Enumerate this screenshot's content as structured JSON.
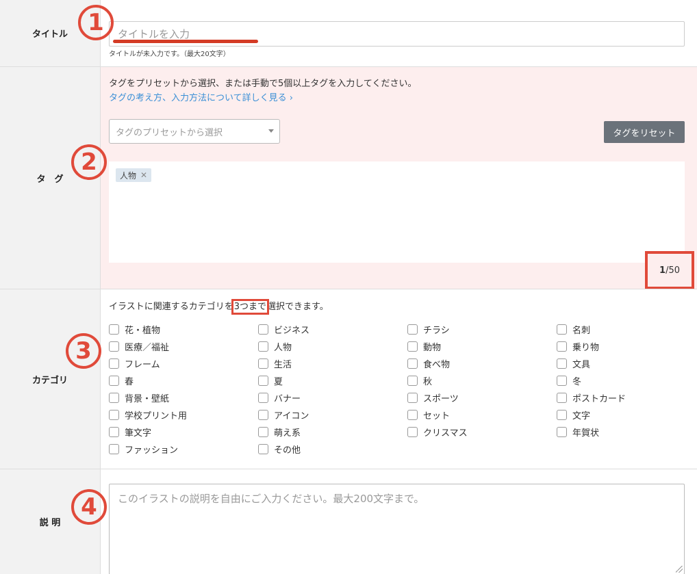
{
  "title_row": {
    "label": "タイトル",
    "placeholder": "タイトルを入力",
    "help": "タイトルが未入力です。（最大20文字）",
    "marker": "1"
  },
  "tag_row": {
    "label": "タ　グ",
    "intro": "タグをプリセットから選択、または手動で5個以上タグを入力してください。",
    "link": "タグの考え方、入力方法について詳しく見る ›",
    "preset_placeholder": "タグのプリセットから選択",
    "reset_label": "タグをリセット",
    "tags": [
      "人物"
    ],
    "count_current": "1",
    "count_max": "/50",
    "marker": "2"
  },
  "category_row": {
    "label": "カテゴリ",
    "intro_before": "イラストに関連するカテゴリを",
    "intro_boxed": "3つまで",
    "intro_after": "選択できます。",
    "marker": "3",
    "items": [
      "花・植物",
      "ビジネス",
      "チラシ",
      "名刺",
      "医療／福祉",
      "人物",
      "動物",
      "乗り物",
      "フレーム",
      "生活",
      "食べ物",
      "文具",
      "春",
      "夏",
      "秋",
      "冬",
      "背景・壁紙",
      "バナー",
      "スポーツ",
      "ポストカード",
      "学校プリント用",
      "アイコン",
      "セット",
      "文字",
      "筆文字",
      "萌え系",
      "クリスマス",
      "年賀状",
      "ファッション",
      "その他"
    ]
  },
  "desc_row": {
    "label": "説 明",
    "placeholder": "このイラストの説明を自由にご入力ください。最大200文字まで。",
    "marker": "4"
  },
  "colors": {
    "accent_red": "#e04a3a",
    "link_blue": "#3a8fd6",
    "tag_bg": "#fdeeee"
  }
}
